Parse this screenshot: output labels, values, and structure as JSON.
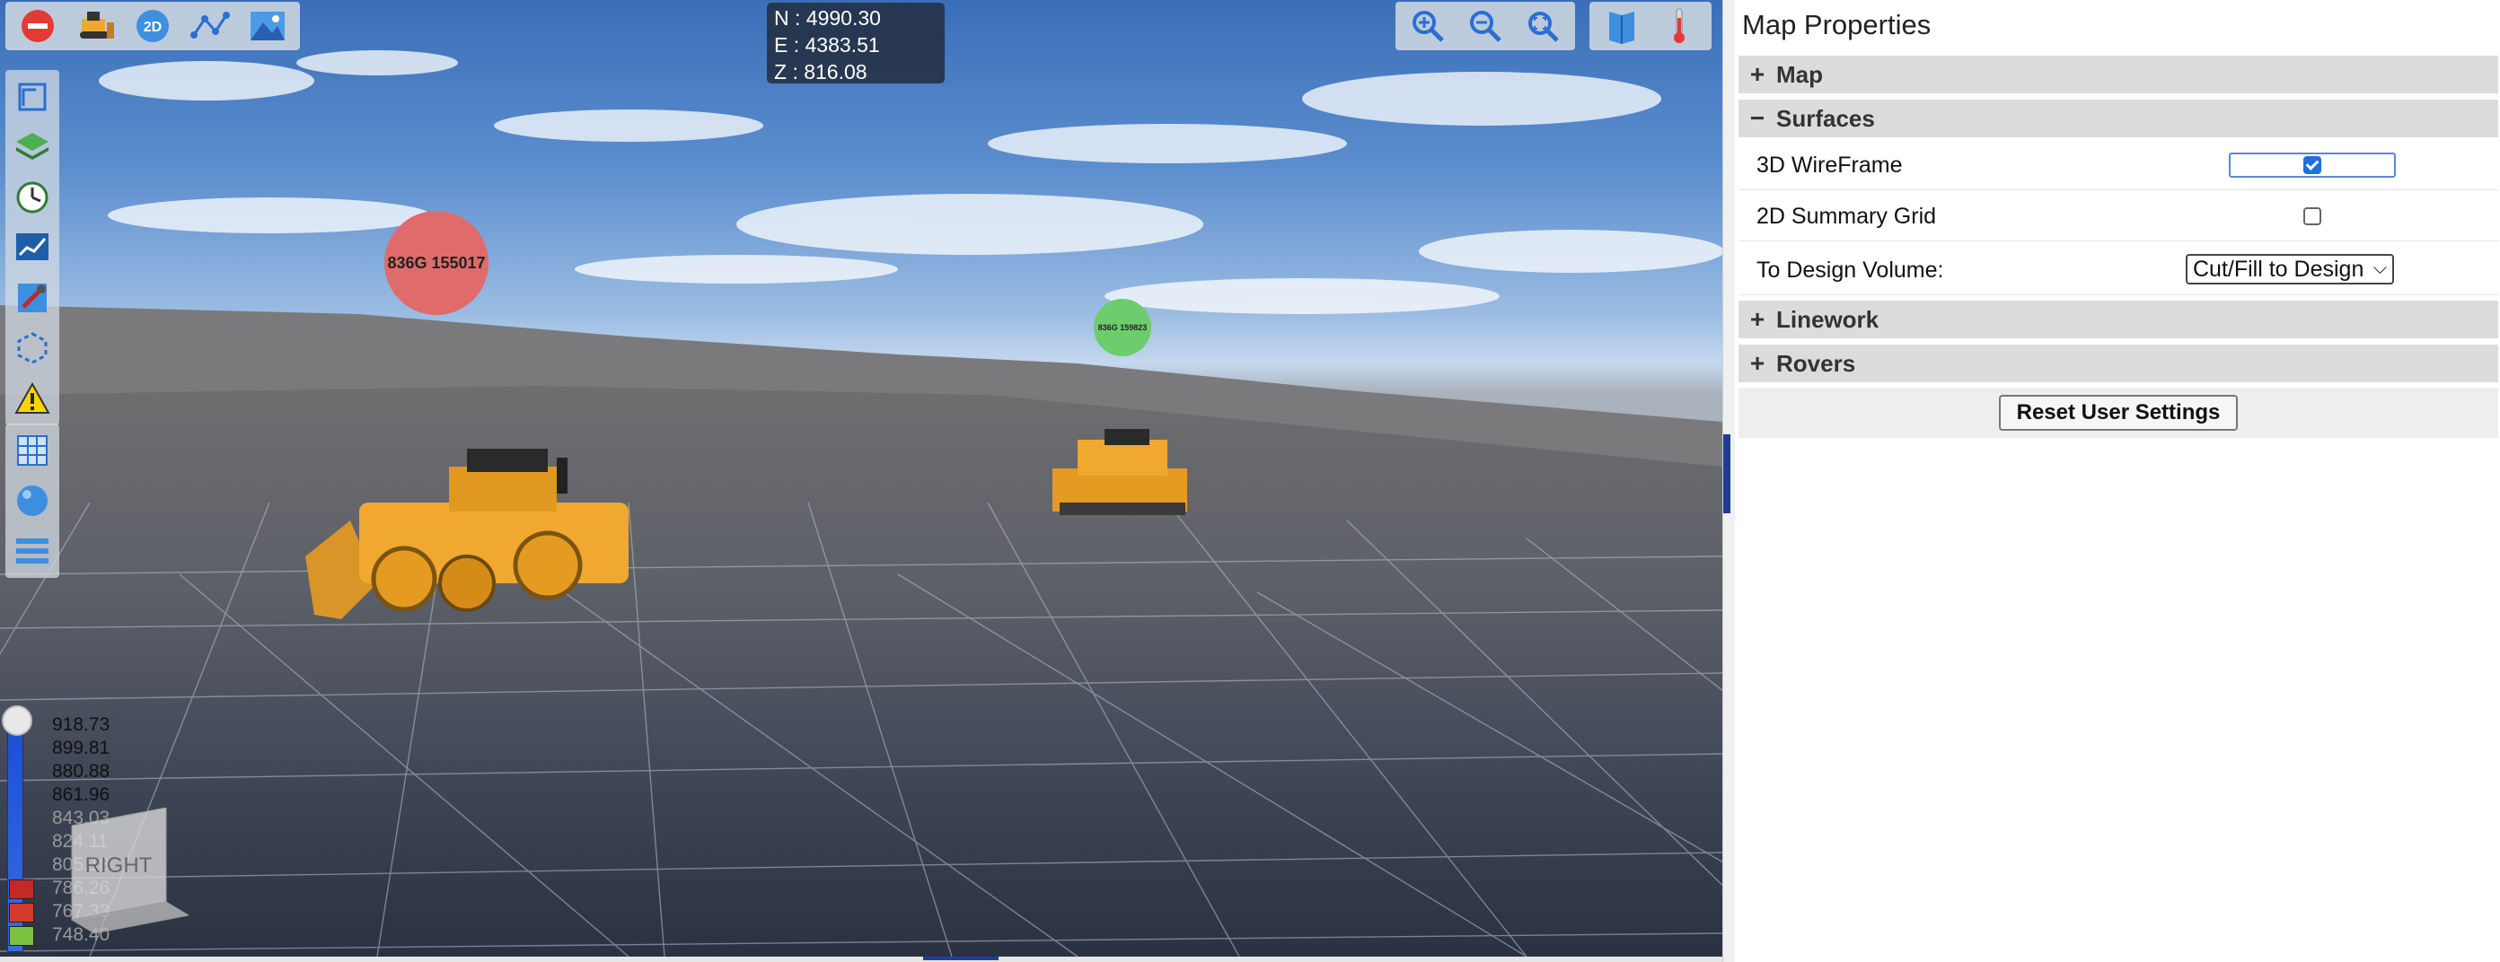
{
  "viewer": {
    "coords": {
      "n": "N : 4990.30",
      "e": "E : 4383.51",
      "z": "Z : 816.08"
    },
    "machines": [
      {
        "label": "836G 155017",
        "status_color": "#e06b6b"
      },
      {
        "label": "836G 159823",
        "status_color": "#6ccd6c"
      }
    ],
    "toolbar_left": [
      {
        "icon": "stop-icon"
      },
      {
        "icon": "bulldozer-icon"
      },
      {
        "icon": "2d-view-icon",
        "label": "2D"
      },
      {
        "icon": "polyline-icon"
      },
      {
        "icon": "landscape-icon"
      }
    ],
    "toolbar_zoom": [
      {
        "icon": "zoom-in-icon"
      },
      {
        "icon": "zoom-out-icon"
      },
      {
        "icon": "zoom-extents-icon"
      }
    ],
    "toolbar_right": [
      {
        "icon": "book-icon"
      },
      {
        "icon": "thermometer-icon"
      }
    ],
    "side_tools_top": [
      "design-icon",
      "layers-icon",
      "history-clock-icon",
      "chart-icon",
      "tools-icon",
      "selection-icon",
      "warning-icon"
    ],
    "side_tools_bottom": [
      "grid-icon",
      "sphere-icon",
      "list-icon"
    ],
    "legend": {
      "values": [
        "918.73",
        "899.81",
        "880.88",
        "861.96",
        "843.03",
        "824.11",
        "805.18",
        "786.26",
        "767.33",
        "748.40"
      ],
      "dim_values": [
        "843.03",
        "824.11",
        "805.18",
        "786.26",
        "767.33",
        "748.40"
      ]
    },
    "view_cube": {
      "face": "RIGHT"
    }
  },
  "panel": {
    "title": "Map Properties",
    "sections": {
      "map": {
        "label": "Map",
        "symbol": "+"
      },
      "surfaces": {
        "label": "Surfaces",
        "symbol": "−"
      },
      "linework": {
        "label": "Linework",
        "symbol": "+"
      },
      "rovers": {
        "label": "Rovers",
        "symbol": "+"
      }
    },
    "surfaces": {
      "wireframe_label": "3D WireFrame",
      "wireframe_checked": true,
      "summary_grid_label": "2D Summary Grid",
      "summary_grid_checked": false,
      "design_volume_label": "To Design Volume:",
      "design_volume_value": "Cut/Fill to Design"
    },
    "reset_label": "Reset User Settings"
  },
  "colors": {
    "accent": "#1e6fe0",
    "machine_body": "#f0a830",
    "splitter_grip": "#1f3d8f"
  }
}
